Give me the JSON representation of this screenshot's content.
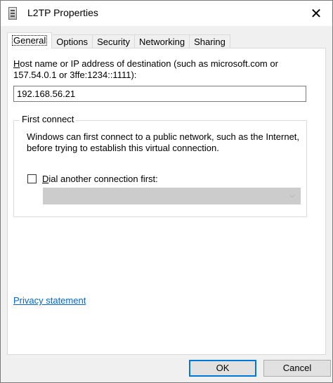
{
  "window": {
    "title": "L2TP Properties",
    "close_glyph": "✕"
  },
  "tabs": [
    {
      "label": "General",
      "active": true
    },
    {
      "label": "Options"
    },
    {
      "label": "Security"
    },
    {
      "label": "Networking"
    },
    {
      "label": "Sharing"
    }
  ],
  "general": {
    "host_label_prefix": "H",
    "host_label_rest": "ost name or IP address of destination (such as microsoft.com or 157.54.0.1 or 3ffe:1234::1111):",
    "host_value": "192.168.56.21",
    "first_connect": {
      "legend": "First connect",
      "description": "Windows can first connect to a public network, such as the Internet, before trying to establish this virtual connection.",
      "dial_label_prefix": "D",
      "dial_label_rest": "ial another connection first:",
      "dial_checked": false
    },
    "privacy_link": "Privacy statement"
  },
  "buttons": {
    "ok": "OK",
    "cancel": "Cancel"
  },
  "colors": {
    "link": "#0066cc",
    "focus_border": "#0078d7"
  }
}
